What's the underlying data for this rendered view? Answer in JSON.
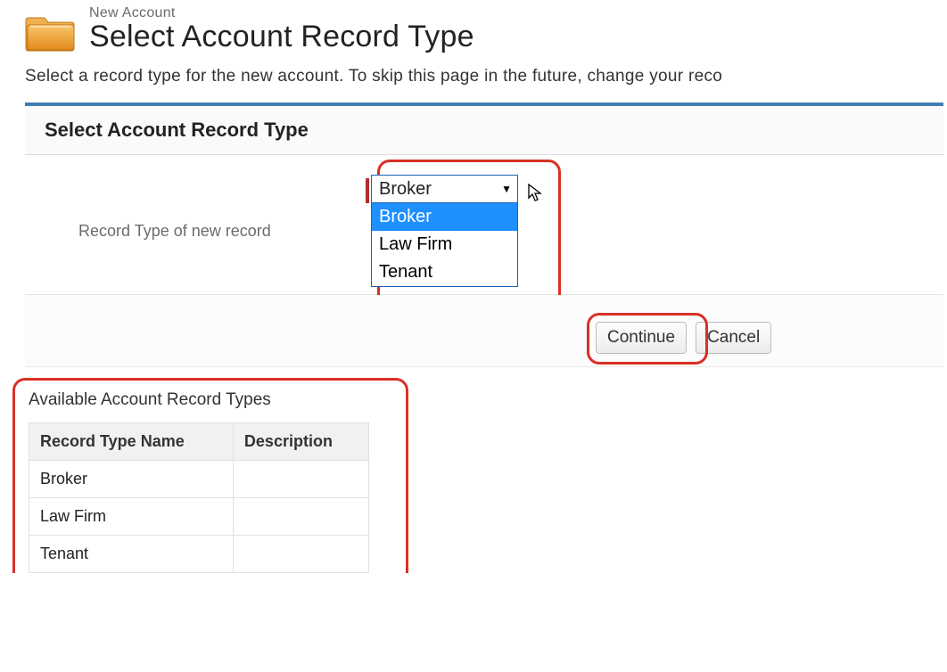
{
  "header": {
    "eyebrow": "New Account",
    "title": "Select Account Record Type"
  },
  "intro": "Select a record type for the new account. To skip this page in the future, change your reco",
  "panel": {
    "title": "Select Account Record Type",
    "field_label": "Record Type of new record",
    "selected": "Broker",
    "options": [
      "Broker",
      "Law Firm",
      "Tenant"
    ],
    "highlighted_option_index": 0
  },
  "buttons": {
    "continue": "Continue",
    "cancel": "Cancel"
  },
  "table": {
    "title": "Available Account Record Types",
    "columns": [
      "Record Type Name",
      "Description"
    ],
    "rows": [
      {
        "name": "Broker",
        "description": ""
      },
      {
        "name": "Law Firm",
        "description": ""
      },
      {
        "name": "Tenant",
        "description": ""
      }
    ]
  }
}
